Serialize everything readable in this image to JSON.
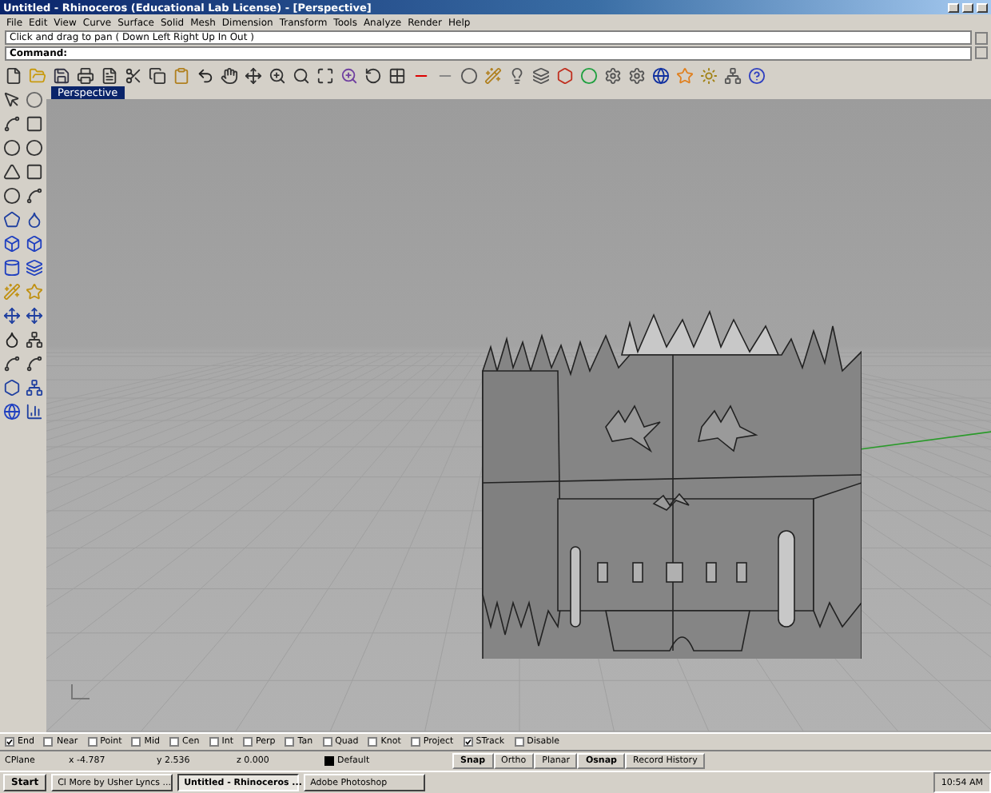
{
  "window": {
    "title": "Untitled - Rhinoceros (Educational Lab License) - [Perspective]"
  },
  "menus": [
    "File",
    "Edit",
    "View",
    "Curve",
    "Surface",
    "Solid",
    "Mesh",
    "Dimension",
    "Transform",
    "Tools",
    "Analyze",
    "Render",
    "Help"
  ],
  "command_history": "Click and drag to pan ( Down  Left  Right  Up  In  Out )",
  "command_prompt": "Command:",
  "viewport": {
    "tab": "Perspective"
  },
  "osnaps": [
    {
      "label": "End",
      "checked": true
    },
    {
      "label": "Near",
      "checked": false
    },
    {
      "label": "Point",
      "checked": false
    },
    {
      "label": "Mid",
      "checked": false
    },
    {
      "label": "Cen",
      "checked": false
    },
    {
      "label": "Int",
      "checked": false
    },
    {
      "label": "Perp",
      "checked": false
    },
    {
      "label": "Tan",
      "checked": false
    },
    {
      "label": "Quad",
      "checked": false
    },
    {
      "label": "Knot",
      "checked": false
    },
    {
      "label": "Project",
      "checked": false
    },
    {
      "label": "STrack",
      "checked": true
    },
    {
      "label": "Disable",
      "checked": false
    }
  ],
  "status": {
    "cplane": "CPlane",
    "x": "x -4.787",
    "y": "y 2.536",
    "z": "z 0.000",
    "layer": "Default",
    "toggles": [
      {
        "label": "Snap",
        "on": true
      },
      {
        "label": "Ortho",
        "on": false
      },
      {
        "label": "Planar",
        "on": false
      },
      {
        "label": "Osnap",
        "on": true
      },
      {
        "label": "Record History",
        "on": false
      }
    ]
  },
  "taskbar": {
    "start": "Start",
    "items": [
      {
        "label": "Cl More by Usher Lyncs ...",
        "selected": false
      },
      {
        "label": "Untitled - Rhinoceros ...",
        "selected": true
      },
      {
        "label": "Adobe Photoshop",
        "selected": false
      }
    ],
    "clock": "10:54 AM"
  }
}
